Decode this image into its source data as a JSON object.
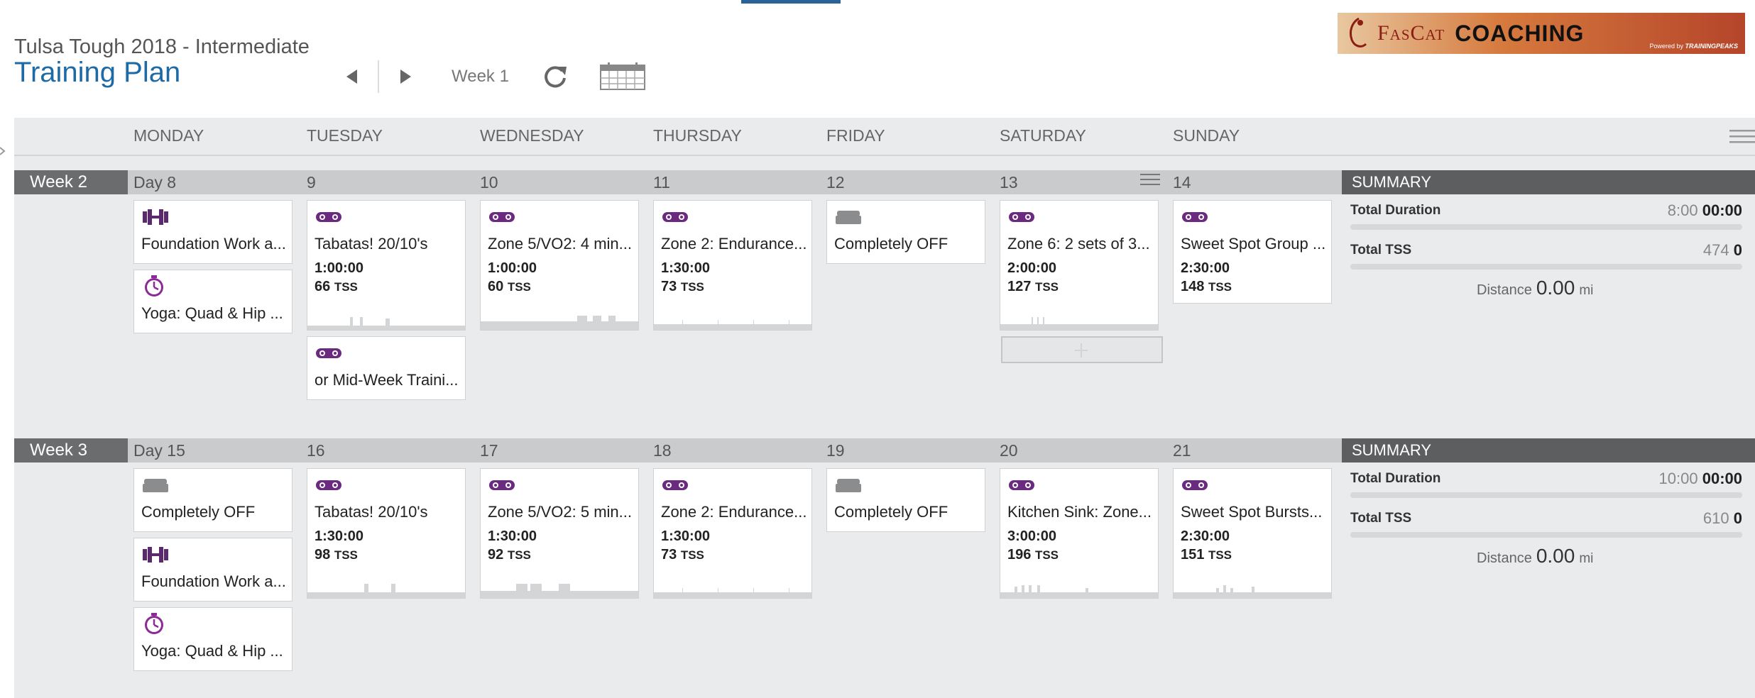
{
  "plan": {
    "subtitle": "Tulsa Tough 2018 - Intermediate",
    "title": "Training Plan"
  },
  "nav": {
    "week_label": "Week 1"
  },
  "logo": {
    "brand": "FasCat",
    "coaching": "COACHING",
    "powered_prefix": "Powered by",
    "powered_brand": "TRAININGPEAKS"
  },
  "days": [
    "MONDAY",
    "TUESDAY",
    "WEDNESDAY",
    "THURSDAY",
    "FRIDAY",
    "SATURDAY",
    "SUNDAY"
  ],
  "colors": {
    "accent": "#1c6aa6",
    "workout_purple": "#6b2a80",
    "off_gray": "#8a8c8e"
  },
  "weeks": [
    {
      "label": "Week 2",
      "day_numbers": [
        "Day 8",
        "9",
        "10",
        "11",
        "12",
        "13",
        "14"
      ],
      "summary": {
        "heading": "SUMMARY",
        "duration_label": "Total Duration",
        "duration_planned": "8:00",
        "duration_done": "00:00",
        "tss_label": "Total TSS",
        "tss_planned": "474",
        "tss_done": "0",
        "distance_label": "Distance",
        "distance_value": "0.00",
        "distance_unit": "mi"
      },
      "cards": {
        "c1": {
          "title": "Foundation Work a...",
          "icon": "strength-icon"
        },
        "c2": {
          "title": "Yoga: Quad & Hip ...",
          "icon": "stopwatch-icon"
        },
        "c3": {
          "title": "Tabatas! 20/10's",
          "duration": "1:00:00",
          "tss": "66",
          "icon": "bike-icon"
        },
        "c4": {
          "title": "or Mid-Week Traini...",
          "icon": "bike-icon"
        },
        "c5": {
          "title": "Zone 5/VO2: 4 min...",
          "duration": "1:00:00",
          "tss": "60",
          "icon": "bike-icon"
        },
        "c6": {
          "title": "Zone 2: Endurance...",
          "duration": "1:30:00",
          "tss": "73",
          "icon": "bike-icon"
        },
        "c7": {
          "title": "Completely OFF",
          "icon": "day-off-icon"
        },
        "c8": {
          "title": "Zone 6: 2 sets of 3...",
          "duration": "2:00:00",
          "tss": "127",
          "icon": "bike-icon"
        },
        "c9": {
          "title": "Sweet Spot Group ...",
          "duration": "2:30:00",
          "tss": "148",
          "icon": "bike-icon"
        }
      }
    },
    {
      "label": "Week 3",
      "day_numbers": [
        "Day 15",
        "16",
        "17",
        "18",
        "19",
        "20",
        "21"
      ],
      "summary": {
        "heading": "SUMMARY",
        "duration_label": "Total Duration",
        "duration_planned": "10:00",
        "duration_done": "00:00",
        "tss_label": "Total TSS",
        "tss_planned": "610",
        "tss_done": "0",
        "distance_label": "Distance",
        "distance_value": "0.00",
        "distance_unit": "mi"
      },
      "cards": {
        "c1": {
          "title": "Completely OFF",
          "icon": "day-off-icon"
        },
        "c2": {
          "title": "Foundation Work a...",
          "icon": "strength-icon"
        },
        "c3": {
          "title": "Yoga: Quad & Hip ...",
          "icon": "stopwatch-icon"
        },
        "c4": {
          "title": "Tabatas! 20/10's",
          "duration": "1:30:00",
          "tss": "98",
          "icon": "bike-icon"
        },
        "c5": {
          "title": "Zone 5/VO2: 5 min...",
          "duration": "1:30:00",
          "tss": "92",
          "icon": "bike-icon"
        },
        "c6": {
          "title": "Zone 2: Endurance...",
          "duration": "1:30:00",
          "tss": "73",
          "icon": "bike-icon"
        },
        "c7": {
          "title": "Completely OFF",
          "icon": "day-off-icon"
        },
        "c8": {
          "title": "Kitchen Sink: Zone...",
          "duration": "3:00:00",
          "tss": "196",
          "icon": "bike-icon"
        },
        "c9": {
          "title": "Sweet Spot Bursts...",
          "duration": "2:30:00",
          "tss": "151",
          "icon": "bike-icon"
        }
      }
    }
  ],
  "tss_unit": "TSS"
}
